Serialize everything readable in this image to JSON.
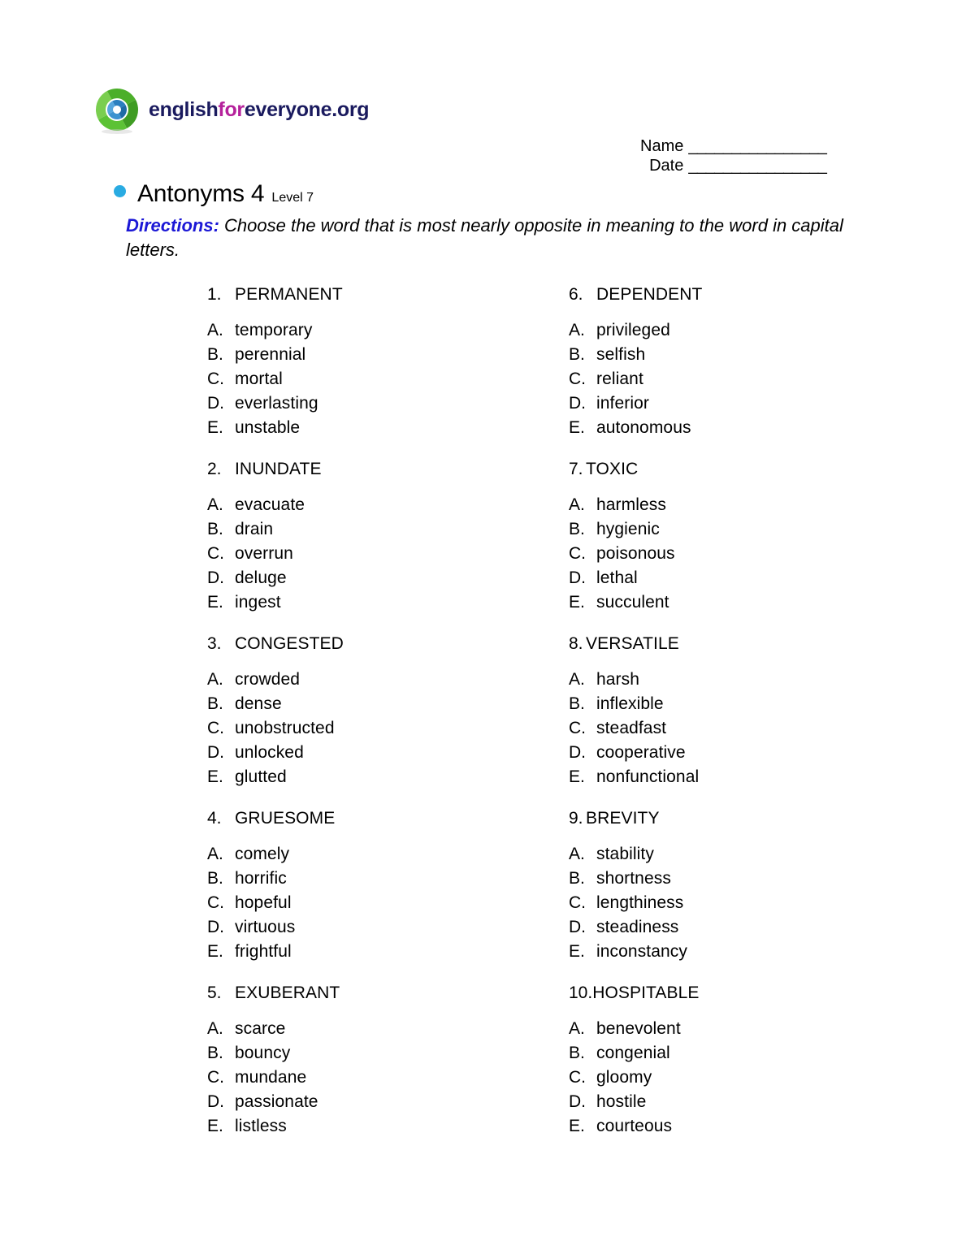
{
  "brand": {
    "logo_icon": "circular-swirl-logo",
    "name_part1": "english",
    "name_part2": "for",
    "name_part3": "everyone.org",
    "color_navy": "#1a1a5e",
    "color_magenta": "#b5219b"
  },
  "header": {
    "name_label": "Name",
    "name_value": "________________",
    "date_label": "Date",
    "date_value": "________________"
  },
  "title": {
    "bullet_color": "#29abe2",
    "heading": "Antonyms 4",
    "level": "Level 7"
  },
  "directions": {
    "label": "Directions:",
    "text": " Choose the word that is most nearly opposite in meaning to the word in capital letters.",
    "label_color": "#1c18d6"
  },
  "questions": {
    "left": [
      {
        "number": "1.",
        "word": "PERMANENT",
        "choices": [
          {
            "letter": "A.",
            "text": "temporary"
          },
          {
            "letter": "B.",
            "text": "perennial"
          },
          {
            "letter": "C.",
            "text": "mortal"
          },
          {
            "letter": "D.",
            "text": "everlasting"
          },
          {
            "letter": "E.",
            "text": "unstable"
          }
        ]
      },
      {
        "number": "2.",
        "word": "INUNDATE",
        "choices": [
          {
            "letter": "A.",
            "text": "evacuate"
          },
          {
            "letter": "B.",
            "text": "drain"
          },
          {
            "letter": "C.",
            "text": "overrun"
          },
          {
            "letter": "D.",
            "text": "deluge"
          },
          {
            "letter": "E.",
            "text": "ingest"
          }
        ]
      },
      {
        "number": "3.",
        "word": "CONGESTED",
        "choices": [
          {
            "letter": "A.",
            "text": "crowded"
          },
          {
            "letter": "B.",
            "text": "dense"
          },
          {
            "letter": "C.",
            "text": "unobstructed"
          },
          {
            "letter": "D.",
            "text": "unlocked"
          },
          {
            "letter": "E.",
            "text": "glutted"
          }
        ]
      },
      {
        "number": "4.",
        "word": "GRUESOME",
        "choices": [
          {
            "letter": "A.",
            "text": "comely"
          },
          {
            "letter": "B.",
            "text": "horrific"
          },
          {
            "letter": "C.",
            "text": "hopeful"
          },
          {
            "letter": "D.",
            "text": "virtuous"
          },
          {
            "letter": "E.",
            "text": "frightful"
          }
        ]
      },
      {
        "number": "5.",
        "word": "EXUBERANT",
        "choices": [
          {
            "letter": "A.",
            "text": "scarce"
          },
          {
            "letter": "B.",
            "text": "bouncy"
          },
          {
            "letter": "C.",
            "text": "mundane"
          },
          {
            "letter": "D.",
            "text": "passionate"
          },
          {
            "letter": "E.",
            "text": "listless"
          }
        ]
      }
    ],
    "right": [
      {
        "number": "6.",
        "word": "DEPENDENT",
        "choices": [
          {
            "letter": "A.",
            "text": "privileged"
          },
          {
            "letter": "B.",
            "text": "selfish"
          },
          {
            "letter": "C.",
            "text": "reliant"
          },
          {
            "letter": "D.",
            "text": "inferior"
          },
          {
            "letter": "E.",
            "text": "autonomous"
          }
        ]
      },
      {
        "number": "7.",
        "word": "TOXIC",
        "choices": [
          {
            "letter": "A.",
            "text": "harmless"
          },
          {
            "letter": "B.",
            "text": "hygienic"
          },
          {
            "letter": "C.",
            "text": "poisonous"
          },
          {
            "letter": "D.",
            "text": "lethal"
          },
          {
            "letter": "E.",
            "text": "succulent"
          }
        ]
      },
      {
        "number": "8.",
        "word": "VERSATILE",
        "choices": [
          {
            "letter": "A.",
            "text": "harsh"
          },
          {
            "letter": "B.",
            "text": "inflexible"
          },
          {
            "letter": "C.",
            "text": "steadfast"
          },
          {
            "letter": "D.",
            "text": "cooperative"
          },
          {
            "letter": "E.",
            "text": "nonfunctional"
          }
        ]
      },
      {
        "number": "9.",
        "word": "BREVITY",
        "choices": [
          {
            "letter": "A.",
            "text": "stability"
          },
          {
            "letter": "B.",
            "text": "shortness"
          },
          {
            "letter": "C.",
            "text": "lengthiness"
          },
          {
            "letter": "D.",
            "text": "steadiness"
          },
          {
            "letter": "E.",
            "text": "inconstancy"
          }
        ]
      },
      {
        "number": "10.",
        "word": "HOSPITABLE",
        "choices": [
          {
            "letter": "A.",
            "text": "benevolent"
          },
          {
            "letter": "B.",
            "text": "congenial"
          },
          {
            "letter": "C.",
            "text": "gloomy"
          },
          {
            "letter": "D.",
            "text": "hostile"
          },
          {
            "letter": "E.",
            "text": "courteous"
          }
        ]
      }
    ]
  }
}
